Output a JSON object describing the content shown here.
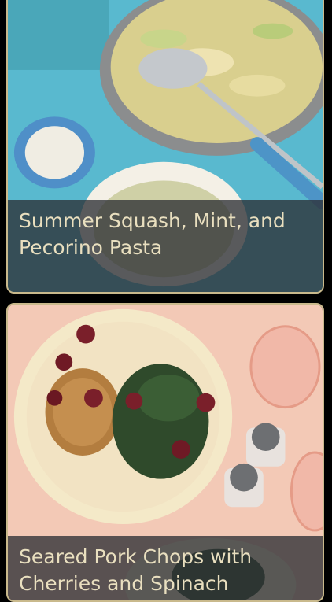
{
  "recipes": [
    {
      "title": "Summer Squash, Mint, and Pecorino Pasta",
      "image": "pasta-skillet-photo"
    },
    {
      "title": "Seared Pork Chops with Cherries and Spinach",
      "image": "pork-chop-plate-photo"
    }
  ],
  "colors": {
    "card_border": "#c9b98c",
    "caption_text": "#e9dfbf",
    "caption_bg": "#2d3034"
  }
}
